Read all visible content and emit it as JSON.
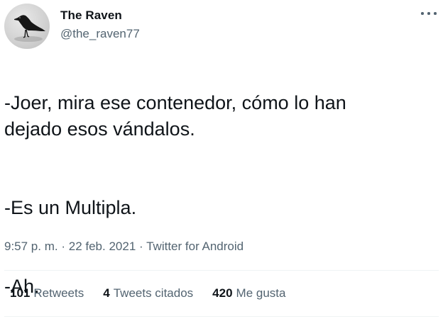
{
  "author": {
    "name": "The Raven",
    "handle": "@the_raven77"
  },
  "tweet": {
    "lines": [
      "-Joer, mira ese contenedor, cómo lo han dejado esos vándalos.",
      "-Es un Multipla.",
      "-Ah."
    ]
  },
  "meta": {
    "time": "9:57 p. m.",
    "separator1": "·",
    "date": "22 feb. 2021",
    "separator2": "·",
    "source": "Twitter for Android"
  },
  "stats": {
    "retweets_count": "101",
    "retweets_label": "Retweets",
    "quotes_count": "4",
    "quotes_label": "Tweets citados",
    "likes_count": "420",
    "likes_label": "Me gusta"
  },
  "colors": {
    "text_primary": "#0f1419",
    "text_secondary": "#536471",
    "divider": "#eff3f4"
  },
  "icons": {
    "more": "more-horizontal-icon",
    "avatar": "raven-avatar"
  }
}
